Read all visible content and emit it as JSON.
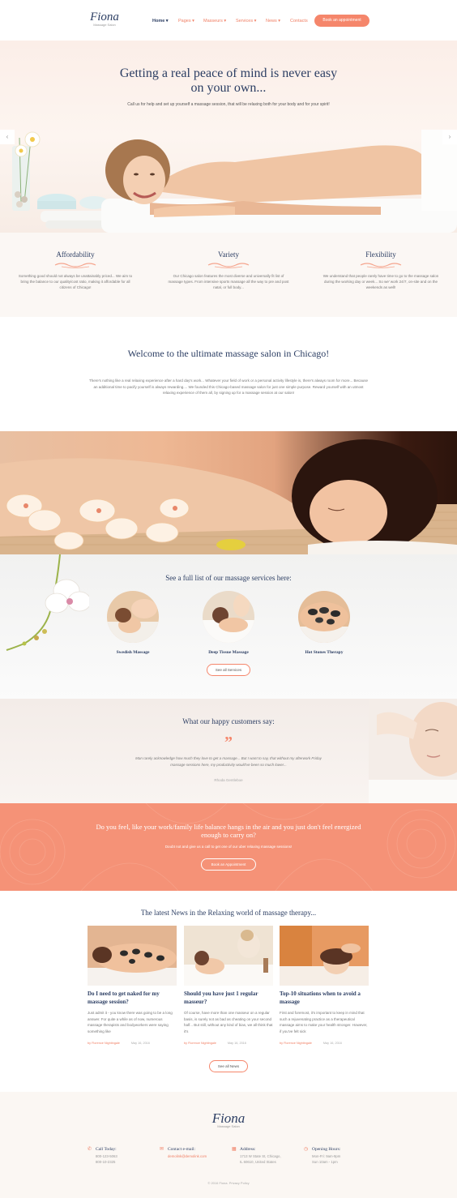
{
  "colors": {
    "accent": "#f5866b",
    "navy": "#2c3e63",
    "cta_bg": "#f59277"
  },
  "header": {
    "logo": "Fiona",
    "logo_sub": "Massage Salon",
    "nav": [
      {
        "label": "Home ▾",
        "active": true
      },
      {
        "label": "Pages ▾"
      },
      {
        "label": "Masseurs ▾"
      },
      {
        "label": "Services ▾"
      },
      {
        "label": "News ▾"
      },
      {
        "label": "Contacts"
      }
    ],
    "book_button": "Book an appointment"
  },
  "hero": {
    "title": "Getting a real peace of mind is never easy on your own...",
    "subtitle": "Call us for help and set up yourself a massage session, that will be relaxing both for your body and for your spirit!",
    "prev_icon": "‹",
    "next_icon": "›"
  },
  "features": [
    {
      "title": "Affordability",
      "text": "Something good should not always be unattainably priced... We aim to bring the balance to our quality/cost ratio, making it affordable for all citizens of Chicago!"
    },
    {
      "title": "Variety",
      "text": "Our Chicago salon features the most diverse and universally fit list of massage types. From intensive sports massage all the way to pre and post natal, or full body..."
    },
    {
      "title": "Flexibility",
      "text": "We understand that people rarely have time to go to the massage salon during the working day or week... So we' work 24/7, on-site and on the weekends as well!"
    }
  ],
  "welcome": {
    "title": "Welcome to the ultimate massage salon in Chicago!",
    "text": "There's nothing like a real relaxing experience after a hard day's work... Whatever your field of work or a personal activity lifestyle is, there's always room for more... Because an additional time to pacify yourself is always rewarding.... We founded this Chicago-based massage salon for just one simple purpose. Reward yourself with an utmost relaxing experience of them all, by signing up for a massage session at our salon!"
  },
  "services": {
    "title": "See a full list of our massage services here:",
    "items": [
      {
        "label": "Swedish Massage"
      },
      {
        "label": "Deep Tissue Massage"
      },
      {
        "label": "Hot Stones Therapy"
      }
    ],
    "button": "See all Services"
  },
  "testimonials": {
    "title": "What our happy customers say:",
    "quote_mark": "”",
    "text": "Man rarely acknowledge how much they love to get a massage... But I want to say, that without my afterwork Friday massage sessions here, my productivity would've been so much lower...",
    "author": "Rhoda Gentleboe"
  },
  "cta": {
    "title": "Do you feel, like your work/family life balance hangs in the air and you just don't feel energized enough to carry on?",
    "subtitle": "Doubt not and give us a call to get one of our uber relaxing massage sessions!",
    "button": "Book an Appointment"
  },
  "news": {
    "title": "The latest News in the Relaxing world of massage therapy...",
    "items": [
      {
        "title": "Do I need to get naked for my massage session?",
        "text": "Just admit it - you know there was going to be a long answer. For quite a while as of now, numerous massage therapists and bodyworkers were saying something like",
        "author": "by Florence Nightingale",
        "date": "May 16, 2016"
      },
      {
        "title": "Should you have just 1 regular masseur?",
        "text": "Of course, have more than one masseur on a regular basis, is surely not as bad as cheating on your second half... But still, without any kind of bias, we all think that it's",
        "author": "by Florence Nightingale",
        "date": "May 16, 2016"
      },
      {
        "title": "Top-10 situations when to avoid a massage",
        "text": "First and foremost, it's important to keep in mind that such a rejuvenating practice as a therapeutical massage aims to make your health stronger. However, if you've felt sick",
        "author": "by Florence Nightingale",
        "date": "May 16, 2016"
      }
    ],
    "button": "See all News"
  },
  "footer": {
    "logo": "Fiona",
    "logo_sub": "Massage Salon",
    "columns": [
      {
        "label": "Call Today:",
        "icon": "phone-icon",
        "glyph": "✆",
        "lines": [
          "800-123-5063",
          "800-10-2325"
        ]
      },
      {
        "label": "Contact e-mail:",
        "icon": "mail-icon",
        "glyph": "✉",
        "lines": [
          "demolink@demolink.com"
        ]
      },
      {
        "label": "Address:",
        "icon": "map-icon",
        "glyph": "▦",
        "lines": [
          "1713 W State St, Chicago,",
          "IL 60610, United States"
        ]
      },
      {
        "label": "Opening Hours:",
        "icon": "clock-icon",
        "glyph": "◷",
        "lines": [
          "Mon-Fri: 9am-9pm",
          "Sun 10am - 1pm"
        ]
      }
    ],
    "copyright": "© 2016 Fiona. Privacy Policy"
  }
}
